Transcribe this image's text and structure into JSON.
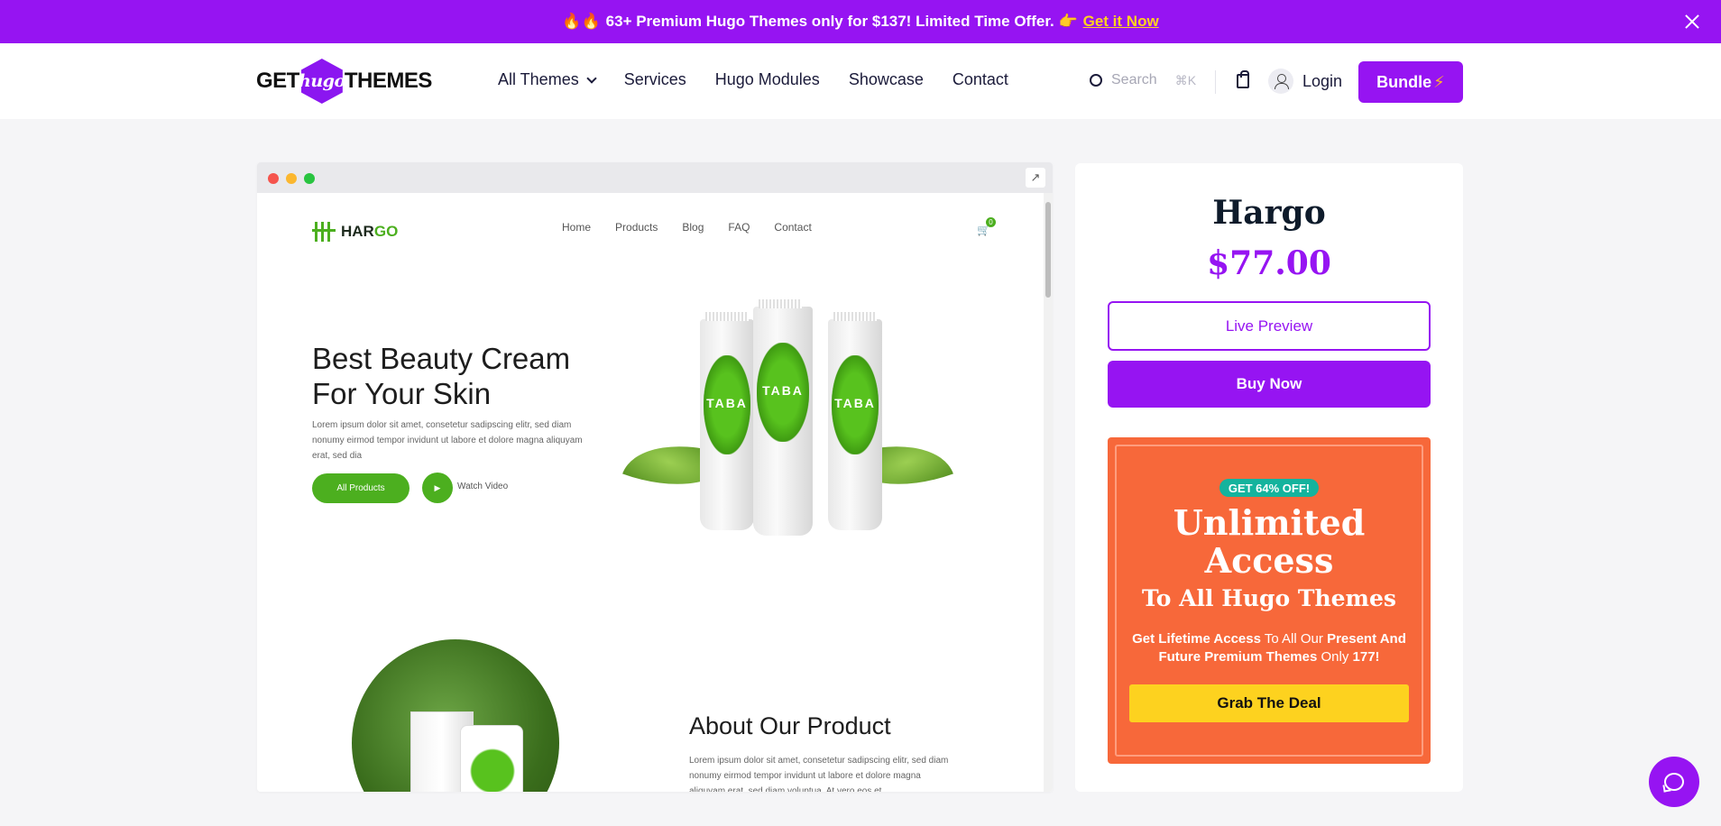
{
  "announcement": {
    "emoji": "🔥🔥",
    "text": "63+ Premium Hugo Themes only for $137! Limited Time Offer. 👉",
    "link_text": "Get it Now"
  },
  "header": {
    "logo_left": "GET",
    "logo_mid": "hugo",
    "logo_right": "THEMES",
    "nav": [
      "All Themes",
      "Services",
      "Hugo Modules",
      "Showcase",
      "Contact"
    ],
    "search_placeholder": "Search",
    "search_shortcut": "⌘K",
    "login": "Login",
    "bundle": "Bundle",
    "bundle_icon": "⚡"
  },
  "preview": {
    "traffic_colors": [
      "#f5544d",
      "#fbb72f",
      "#29c440"
    ],
    "open_icon": "↗",
    "site": {
      "logo_a": "HAR",
      "logo_b": "GO",
      "nav": [
        "Home",
        "Products",
        "Blog",
        "FAQ",
        "Contact"
      ],
      "cart_count": "0",
      "hero_title": "Best Beauty Cream For Your Skin",
      "hero_text": "Lorem ipsum dolor sit amet, consetetur sadipscing elitr, sed diam nonumy eirmod tempor invidunt ut labore et dolore magna aliquyam erat, sed dia",
      "all_products": "All Products",
      "play_icon": "▶",
      "watch_video": "Watch Video",
      "tube_word": "TABA",
      "about_title": "About Our Product",
      "about_text": "Lorem ipsum dolor sit amet, consetetur sadipscing elitr, sed diam nonumy eirmod tempor invidunt ut labore et dolore magna aliquyam erat, sed diam voluptua. At vero eos et"
    }
  },
  "sidebar": {
    "title": "Hargo",
    "price": "$77.00",
    "live_preview": "Live Preview",
    "buy_now": "Buy Now",
    "promo": {
      "badge": "GET 64% OFF!",
      "heading": "Unlimited Access",
      "subheading": "To All Hugo Themes",
      "desc_b1": "Get Lifetime Access",
      "desc_t1": " To All Our ",
      "desc_b2": "Present And Future Premium Themes",
      "desc_t2": " Only ",
      "desc_b3": "177!",
      "cta": "Grab The Deal"
    }
  },
  "colors": {
    "brand": "#9614f2",
    "green": "#4caf1f",
    "promo": "#f7683a",
    "cta": "#fdd21f"
  }
}
